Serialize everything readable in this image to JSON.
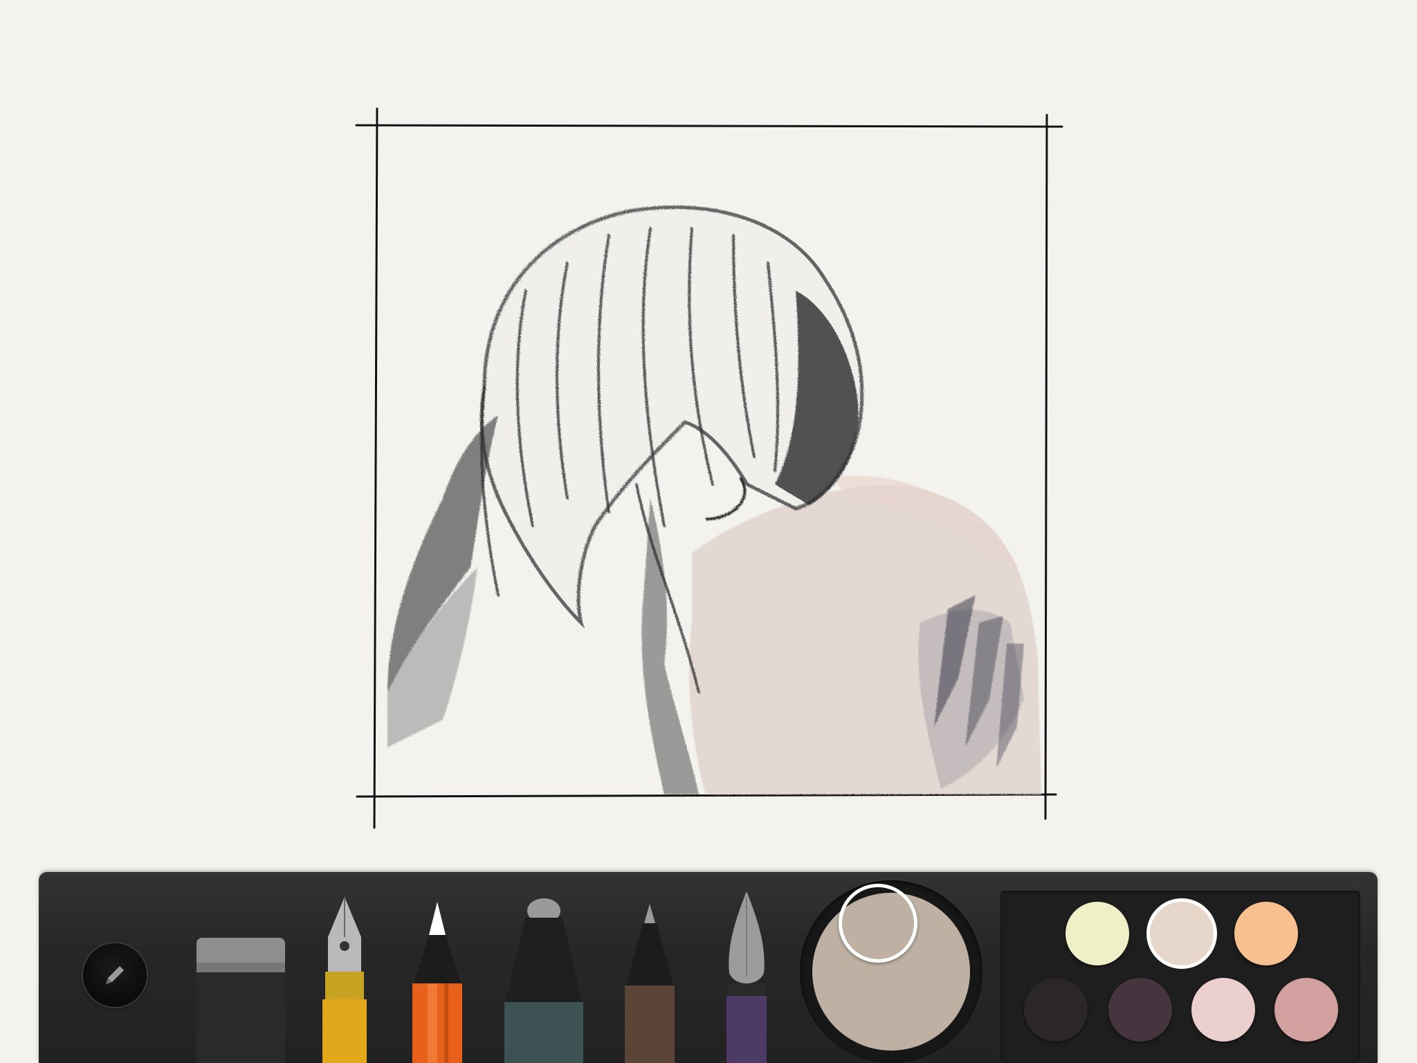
{
  "app": {
    "canvas_background": "#f3f2ee"
  },
  "canvas": {
    "artwork": "pencil-sketch-embrace"
  },
  "toolbar": {
    "menu_icon": "pencil-icon",
    "tools": [
      {
        "name": "eraser",
        "icon": "eraser-icon",
        "color": "#2a2a2a"
      },
      {
        "name": "fountain-pen",
        "icon": "fountain-pen-icon",
        "color": "#e0a81a"
      },
      {
        "name": "pencil",
        "icon": "pencil-tool-icon",
        "color": "#e8611c"
      },
      {
        "name": "marker",
        "icon": "marker-icon",
        "color": "#3d5253"
      },
      {
        "name": "pen",
        "icon": "fineliner-icon",
        "color": "#5a4435"
      },
      {
        "name": "brush",
        "icon": "watercolor-brush-icon",
        "color": "#4d3b66"
      }
    ],
    "current_color": "#beb1a4",
    "swatches": [
      {
        "color": "#efefc8",
        "selected": false
      },
      {
        "color": "#e6d7ca",
        "selected": true
      },
      {
        "color": "#f7c08e",
        "selected": false
      },
      {
        "color": "#2b2627",
        "selected": false
      },
      {
        "color": "#45353f",
        "selected": false
      },
      {
        "color": "#ebcfce",
        "selected": false
      },
      {
        "color": "#d2a09f",
        "selected": false
      }
    ]
  }
}
